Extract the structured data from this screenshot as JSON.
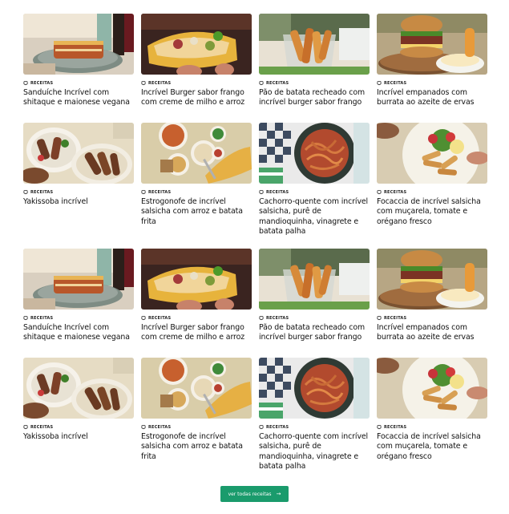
{
  "category_label": "RECEITAS",
  "cta": {
    "label": "ver todas receitas",
    "arrow": "→"
  },
  "icons": {
    "category": "bookmark-tag-icon",
    "cta": "arrow-right-icon"
  },
  "colors": {
    "accent": "#1a9b6c"
  },
  "recipes": [
    {
      "title": "Sanduíche Incrível com shitaque e maionese vegana",
      "image": "lasagna-sandwich-photo"
    },
    {
      "title": "Incrível Burger sabor frango com creme de milho e arroz",
      "image": "taco-photo"
    },
    {
      "title": "Pão de batata recheado com incrível burger sabor frango",
      "image": "potato-bread-photo"
    },
    {
      "title": "Incrível empanados com burrata ao azeite de ervas",
      "image": "burger-burrata-photo"
    },
    {
      "title": "Yakissoba incrível",
      "image": "yakissoba-plates-photo"
    },
    {
      "title": "Estrogonofe de incrível salsicha com arroz e  batata frita",
      "image": "stroganoff-table-photo"
    },
    {
      "title": "Cachorro-quente com incrível salsicha, purê de mandioquinha, vinagrete e batata palha",
      "image": "spaghetti-plate-photo"
    },
    {
      "title": "Focaccia de incrível salsicha com muçarela, tomate e orégano fresco",
      "image": "sausage-salad-photo"
    },
    {
      "title": "Sanduíche Incrível com shitaque e maionese vegana",
      "image": "lasagna-sandwich-photo"
    },
    {
      "title": "Incrível Burger sabor frango com creme de milho e arroz",
      "image": "taco-photo"
    },
    {
      "title": "Pão de batata recheado com incrível burger sabor frango",
      "image": "potato-bread-photo"
    },
    {
      "title": "Incrível empanados com burrata ao azeite de ervas",
      "image": "burger-burrata-photo"
    },
    {
      "title": "Yakissoba incrível",
      "image": "yakissoba-plates-photo"
    },
    {
      "title": "Estrogonofe de incrível salsicha com arroz e  batata frita",
      "image": "stroganoff-table-photo"
    },
    {
      "title": "Cachorro-quente com incrível salsicha, purê de mandioquinha, vinagrete e batata palha",
      "image": "spaghetti-plate-photo"
    },
    {
      "title": "Focaccia de incrível salsicha com muçarela, tomate e orégano fresco",
      "image": "sausage-salad-photo"
    }
  ]
}
